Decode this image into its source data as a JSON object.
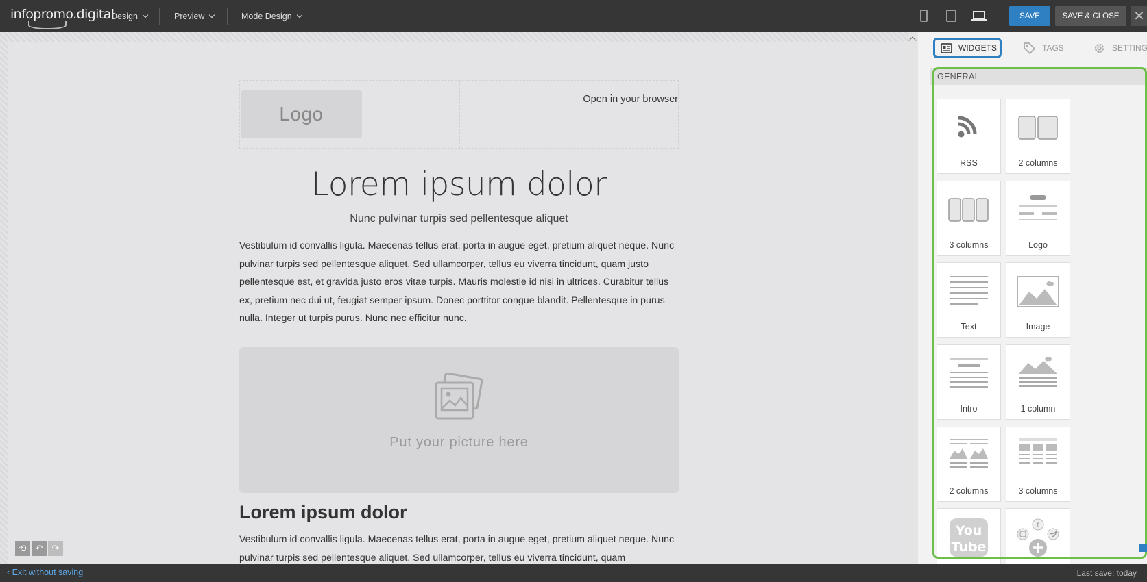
{
  "app": {
    "brand": "infopromo.digital",
    "menu": [
      "Design",
      "Preview",
      "Mode Design"
    ],
    "save_label": "SAVE",
    "save_close_label": "SAVE & CLOSE",
    "close_glyph": "✕",
    "accent_color": "#2f80c3",
    "highlight_color": "#6cc04a"
  },
  "devices": [
    "phone-icon",
    "tablet-icon",
    "laptop-icon"
  ],
  "email": {
    "logo": "Logo",
    "open_in_browser": "Open in your browser",
    "title": "Lorem ipsum dolor",
    "subtitle": "Nunc pulvinar turpis sed pellentesque aliquet",
    "paragraph": "Vestibulum id convallis ligula. Maecenas tellus erat, porta in augue eget, pretium aliquet neque. Nunc pulvinar turpis sed pellentesque aliquet. Sed ullamcorper, tellus eu viverra tincidunt, quam justo pellentesque est, et gravida justo eros vitae turpis. Mauris molestie id nisi in ultrices. Curabitur tellus ex, pretium nec dui ut, feugiat semper ipsum. Donec porttitor congue blandit. Pellentesque in purus nulla. Integer ut turpis purus. Nunc nec efficitur nunc.",
    "picture_placeholder": "Put your picture here",
    "section_title": "Lorem ipsum dolor",
    "paragraph2": "Vestibulum id convallis ligula. Maecenas tellus erat, porta in augue eget, pretium aliquet neque. Nunc pulvinar turpis sed pellentesque aliquet. Sed ullamcorper, tellus eu viverra tincidunt, quam"
  },
  "panel": {
    "tabs": [
      "WIDGETS",
      "TAGS",
      "SETTING"
    ],
    "section": "GENERAL",
    "widgets": [
      "RSS",
      "2 columns",
      "3 columns",
      "Logo",
      "Text",
      "Image",
      "Intro",
      "1 column",
      "2 columns",
      "3 columns"
    ]
  },
  "footer": {
    "exit": "Exit without saving",
    "last_save": "Last save: today"
  }
}
